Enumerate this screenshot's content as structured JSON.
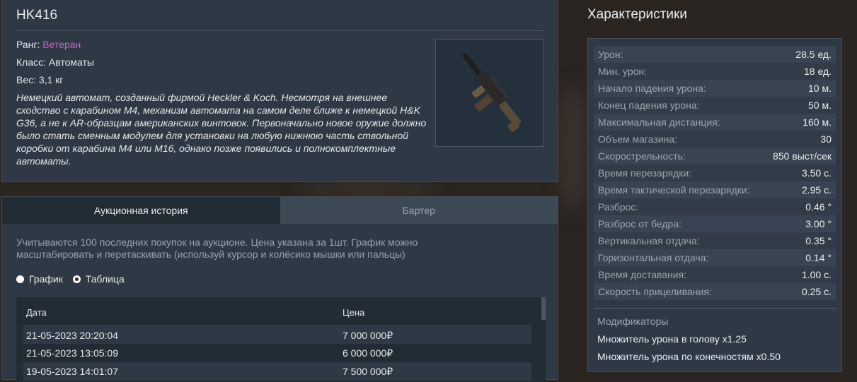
{
  "item": {
    "name": "HK416",
    "rank_label": "Ранг:",
    "rank_value": "Ветеран",
    "class_line": "Класс: Автоматы",
    "weight_line": "Вес: 3,1 кг",
    "description": "Немецкий автомат, созданный фирмой Heckler & Koch. Несмотря на внешнее сходство с карабином M4, механизм автомата на самом деле ближе к немецкой H&K G36, а не к AR-образцам американских винтовок. Первоначально новое оружие должно было стать сменным модулем для установки на любую нижнюю часть ствольной коробки от карабина M4 или M16, однако позже появились и полнокомплектные автоматы."
  },
  "auction": {
    "tabs": [
      {
        "label": "Аукционная история",
        "active": true
      },
      {
        "label": "Бартер",
        "active": false
      }
    ],
    "note": "Учитываются 100 последних покупок на аукционе. Цена указана за 1шт. График можно масштабировать и перетаскивать (используй курсор и колёсико мышки или пальцы)",
    "view_options": [
      {
        "label": "График",
        "selected": false
      },
      {
        "label": "Таблица",
        "selected": true
      }
    ],
    "table": {
      "columns": [
        "Дата",
        "Цена"
      ],
      "rows": [
        {
          "date": "21-05-2023 20:20:04",
          "price": "7 000 000₽"
        },
        {
          "date": "21-05-2023 13:05:09",
          "price": "6 000 000₽"
        },
        {
          "date": "19-05-2023 14:01:07",
          "price": "7 500 000₽"
        }
      ]
    }
  },
  "characteristics": {
    "title": "Характеристики",
    "stats": [
      {
        "label": "Урон:",
        "value": "28.5 ед."
      },
      {
        "label": "Мин. урон:",
        "value": "18 ед."
      },
      {
        "label": "Начало падения урона:",
        "value": "10 м."
      },
      {
        "label": "Конец падения урона:",
        "value": "50 м."
      },
      {
        "label": "Максимальная дистанция:",
        "value": "160 м."
      },
      {
        "label": "Объем магазина:",
        "value": "30"
      },
      {
        "label": "Скорострельность:",
        "value": "850 выст/сек"
      },
      {
        "label": "Время перезарядки:",
        "value": "3.50 с."
      },
      {
        "label": "Время тактической перезарядки:",
        "value": "2.95 с."
      },
      {
        "label": "Разброс:",
        "value": "0.46 °"
      },
      {
        "label": "Разброс от бедра:",
        "value": "3.00 °"
      },
      {
        "label": "Вертикальная отдача:",
        "value": "0.35 °"
      },
      {
        "label": "Горизонтальная отдача:",
        "value": "0.14 °"
      },
      {
        "label": "Время доставания:",
        "value": "1.00 с."
      },
      {
        "label": "Скорость прицеливания:",
        "value": "0.25 с."
      }
    ],
    "modifiers_title": "Модификаторы",
    "modifiers": [
      "Множитель урона в голову x1.25",
      "Множитель урона по конечностям x0.50"
    ]
  },
  "colors": {
    "panel": "#2e3945",
    "rank": "#c763c9",
    "active_tab": "#222c35",
    "inactive_tab": "#3d4955"
  }
}
